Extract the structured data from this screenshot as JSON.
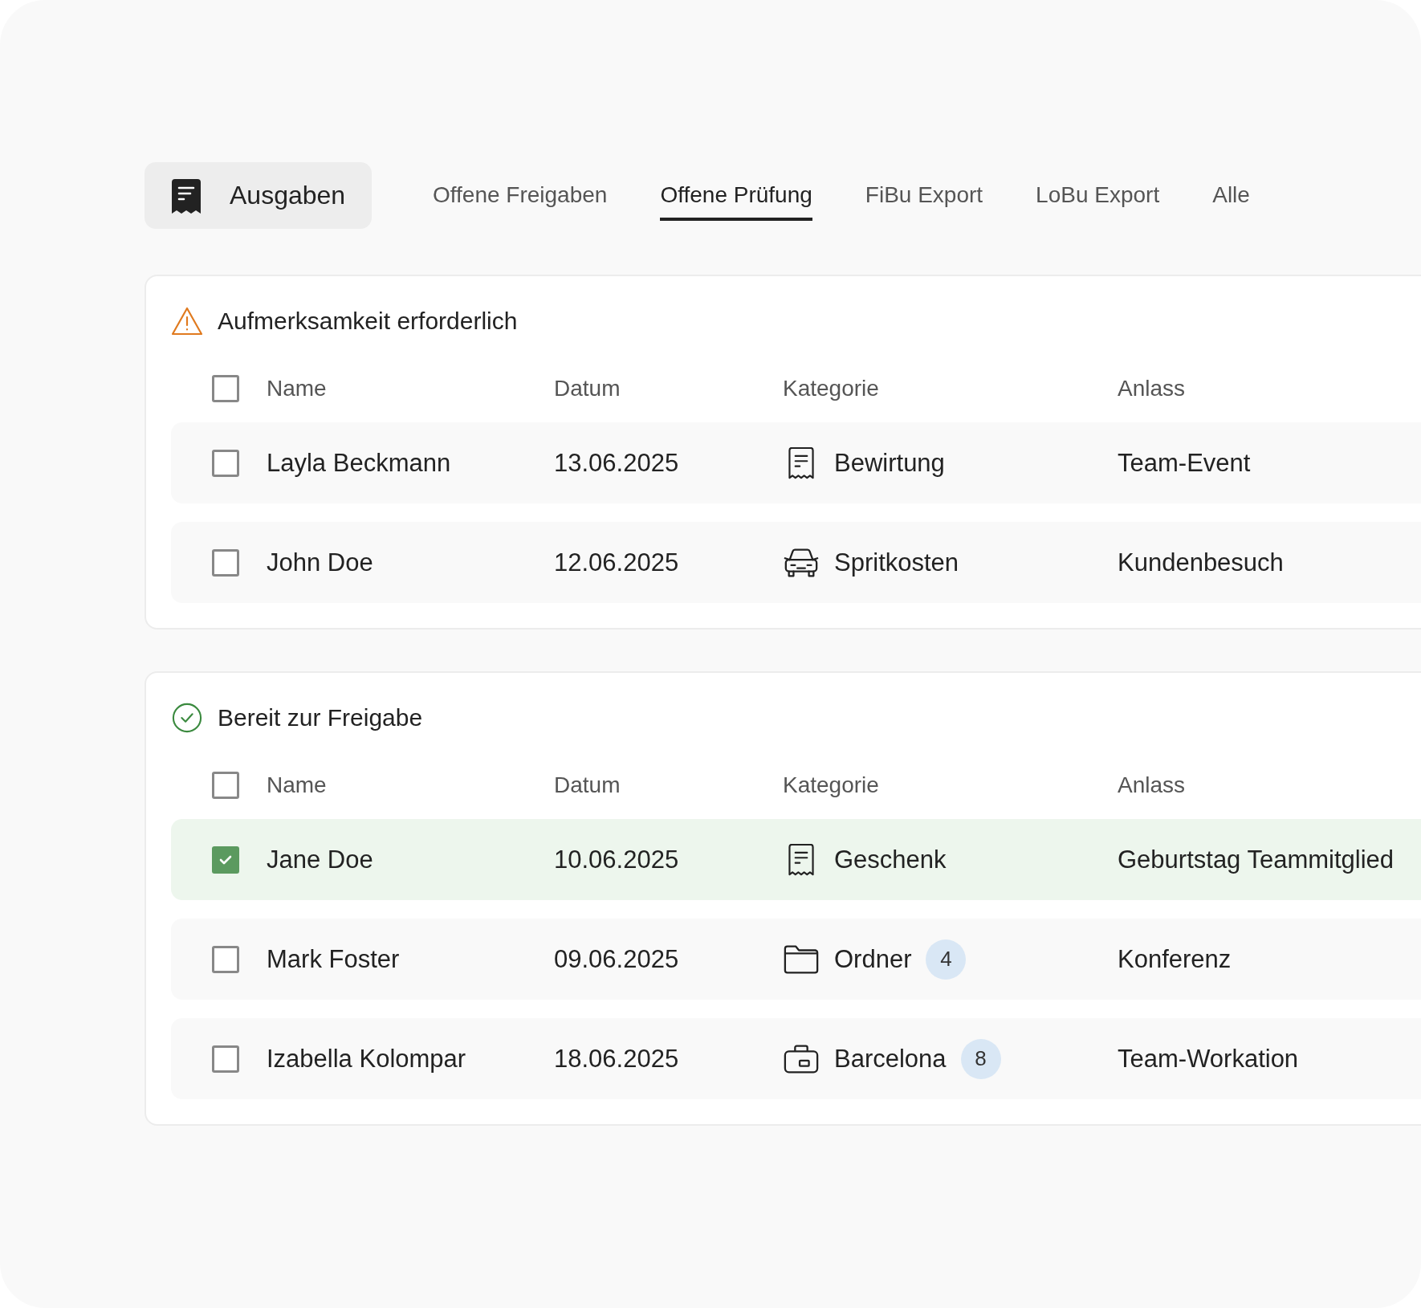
{
  "header": {
    "title": "Ausgaben"
  },
  "tabs": [
    {
      "label": "Offene Freigaben",
      "selected": false
    },
    {
      "label": "Offene Prüfung",
      "selected": true
    },
    {
      "label": "FiBu Export",
      "selected": false
    },
    {
      "label": "LoBu Export",
      "selected": false
    },
    {
      "label": "Alle",
      "selected": false
    }
  ],
  "sections": [
    {
      "kind": "warning",
      "title": "Aufmerksamkeit erforderlich",
      "all_checked": false,
      "columns": [
        "Name",
        "Datum",
        "Kategorie",
        "Anlass"
      ],
      "rows": [
        {
          "checked": false,
          "name": "Layla Beckmann",
          "date": "13.06.2025",
          "category": {
            "kind": "receipt",
            "label": "Bewirtung"
          },
          "occasion": "Team-Event"
        },
        {
          "checked": false,
          "name": "John Doe",
          "date": "12.06.2025",
          "category": {
            "kind": "car",
            "label": "Spritkosten"
          },
          "occasion": "Kundenbesuch"
        }
      ]
    },
    {
      "kind": "ok",
      "title": "Bereit zur Freigabe",
      "all_checked": false,
      "columns": [
        "Name",
        "Datum",
        "Kategorie",
        "Anlass"
      ],
      "rows": [
        {
          "checked": true,
          "name": "Jane Doe",
          "date": "10.06.2025",
          "category": {
            "kind": "receipt",
            "label": "Geschenk"
          },
          "occasion": "Geburtstag Teammitglied"
        },
        {
          "checked": false,
          "name": "Mark Foster",
          "date": "09.06.2025",
          "category": {
            "kind": "folder",
            "label": "Ordner",
            "count": "4"
          },
          "occasion": "Konferenz"
        },
        {
          "checked": false,
          "name": "Izabella Kolompar",
          "date": "18.06.2025",
          "category": {
            "kind": "suitcase",
            "label": "Barcelona",
            "count": "8"
          },
          "occasion": "Team-Workation"
        }
      ]
    }
  ]
}
